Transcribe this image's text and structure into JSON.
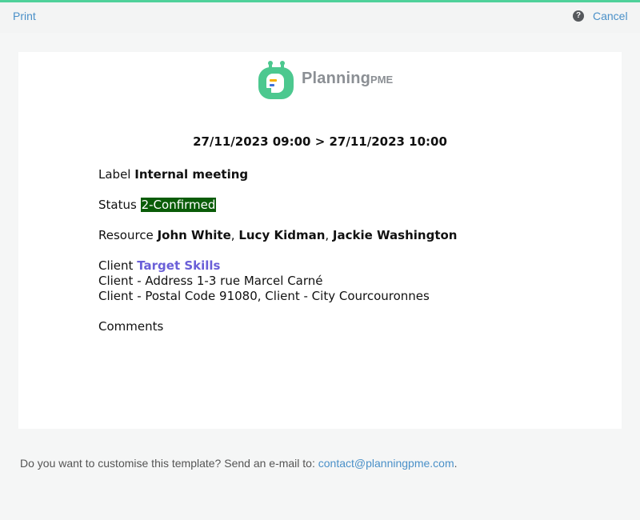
{
  "toolbar": {
    "print_label": "Print",
    "cancel_label": "Cancel",
    "help_glyph": "?"
  },
  "logo": {
    "brand_main": "Planning",
    "brand_suffix": "PME",
    "icon_glyph": "P"
  },
  "event": {
    "daterange": "27/11/2023 09:00 > 27/11/2023 10:00",
    "label_key": "Label",
    "label_value": "Internal meeting",
    "status_key": "Status",
    "status_value": "2-Confirmed",
    "resource_key": "Resource",
    "resources": [
      "John White",
      "Lucy Kidman",
      "Jackie Washington"
    ],
    "resource_sep": ", ",
    "client_key": "Client",
    "client_value": "Target Skills",
    "address_line": "Client - Address 1-3 rue Marcel Carné",
    "postal_line": "Client - Postal Code 91080, Client - City Courcouronnes",
    "comments_key": "Comments"
  },
  "footer": {
    "text": "Do you want to customise this template? Send an e-mail to: ",
    "email": "contact@planningpme.com",
    "end": "."
  },
  "colors": {
    "accent_green": "#4fd19a",
    "link_blue": "#4a90c8",
    "status_bg": "#0a5c08",
    "client_link": "#6a5fd8"
  },
  "icons": {
    "help": "question-circle-icon",
    "logo": "planningpme-logo-icon"
  }
}
